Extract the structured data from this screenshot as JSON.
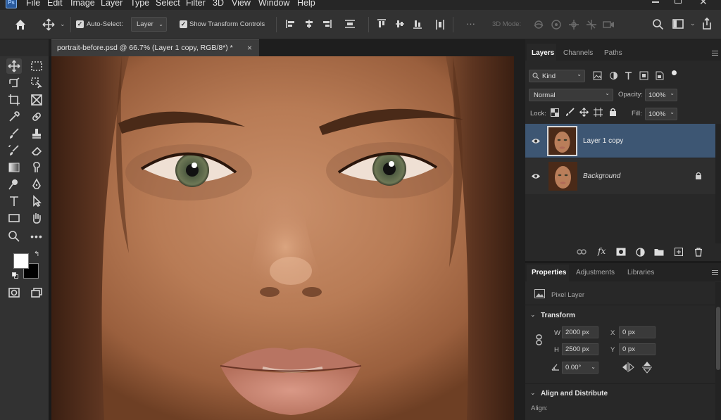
{
  "menubar": {
    "app_badge": "Ps",
    "items": [
      "File",
      "Edit",
      "Image",
      "Layer",
      "Type",
      "Select",
      "Filter",
      "3D",
      "View",
      "Window",
      "Help"
    ]
  },
  "options": {
    "auto_select_label": "Auto-Select:",
    "auto_select_value": "Layer",
    "transform_label": "Show Transform Controls",
    "mode_3d_label": "3D Mode:"
  },
  "document": {
    "tab_title": "portrait-before.psd @ 66.7% (Layer 1 copy, RGB/8*) *",
    "close_glyph": "×"
  },
  "layers_panel": {
    "tabs": [
      "Layers",
      "Channels",
      "Paths"
    ],
    "kind_label": "Kind",
    "blend_mode": "Normal",
    "opacity_label": "Opacity:",
    "opacity_value": "100%",
    "lock_label": "Lock:",
    "fill_label": "Fill:",
    "fill_value": "100%",
    "layers": [
      {
        "name": "Layer 1 copy",
        "visible": true,
        "selected": true
      },
      {
        "name": "Background",
        "visible": true,
        "selected": false,
        "locked": true
      }
    ],
    "footer_fx": "fx"
  },
  "properties_panel": {
    "tabs": [
      "Properties",
      "Adjustments",
      "Libraries"
    ],
    "layer_type": "Pixel Layer",
    "transform_heading": "Transform",
    "w_label": "W",
    "w_value": "2000 px",
    "h_label": "H",
    "h_value": "2500 px",
    "x_label": "X",
    "x_value": "0 px",
    "y_label": "Y",
    "y_value": "0 px",
    "angle_value": "0.00°",
    "align_heading": "Align and Distribute",
    "align_label": "Align:"
  },
  "colors": {
    "accent_selected_layer": "#3d5673",
    "panel_bg": "#282828",
    "toolbar_bg": "#323232",
    "foreground_swatch": "#ffffff",
    "background_swatch": "#000000"
  }
}
